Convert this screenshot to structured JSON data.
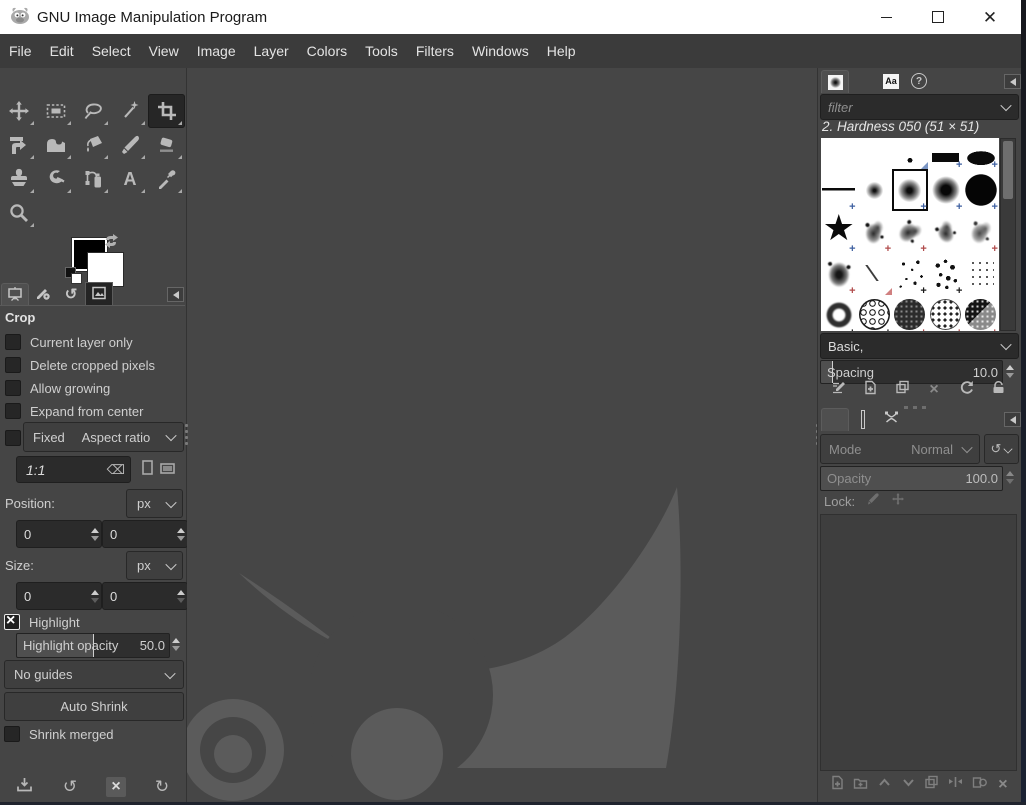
{
  "window": {
    "title": "GNU Image Manipulation Program",
    "controls": [
      "minimize",
      "maximize",
      "close"
    ]
  },
  "menu": {
    "items": [
      "File",
      "Edit",
      "Select",
      "View",
      "Image",
      "Layer",
      "Colors",
      "Tools",
      "Filters",
      "Windows",
      "Help"
    ]
  },
  "toolbox": {
    "selected": "crop",
    "tools": [
      {
        "id": "move"
      },
      {
        "id": "rect-select"
      },
      {
        "id": "free-select"
      },
      {
        "id": "fuzzy-select"
      },
      {
        "id": "crop"
      },
      {
        "id": "unified-transform"
      },
      {
        "id": "warp-transform"
      },
      {
        "id": "bucket-fill"
      },
      {
        "id": "paintbrush"
      },
      {
        "id": "eraser"
      },
      {
        "id": "clone"
      },
      {
        "id": "smudge"
      },
      {
        "id": "airbrush"
      },
      {
        "id": "text"
      },
      {
        "id": "color-picker"
      },
      {
        "id": "zoom"
      }
    ]
  },
  "colors": {
    "foreground": "#000000",
    "background": "#ffffff",
    "canvas_bg": "#464646",
    "watermark": "#5b5b5b",
    "panel_bg": "#454545",
    "menubar_bg": "#3b3b3b",
    "titlebar_bg": "#ffffff",
    "plus_blue": "#3d5fa0",
    "plus_red": "#b04a4a"
  },
  "left_dock_tabs": [
    "tool-options",
    "device-status",
    "undo-history",
    "images"
  ],
  "tool_options": {
    "title": "Crop",
    "checkboxes": [
      {
        "label": "Current layer only",
        "checked": false
      },
      {
        "label": "Delete cropped pixels",
        "checked": false
      },
      {
        "label": "Allow growing",
        "checked": false
      },
      {
        "label": "Expand from center",
        "checked": false
      }
    ],
    "fixed_label": "Fixed",
    "fixed_value": "Aspect ratio",
    "fixed_checked": false,
    "aspect_value": "1:1",
    "position_label": "Position:",
    "position_unit": "px",
    "position_x": "0",
    "position_y": "0",
    "size_label": "Size:",
    "size_unit": "px",
    "size_x": "0",
    "size_y": "0",
    "highlight_label": "Highlight",
    "highlight_checked": true,
    "highlight_opacity_label": "Highlight opacity",
    "highlight_opacity_value": "50.0",
    "highlight_opacity_percent": 50,
    "guides_value": "No guides",
    "auto_shrink_label": "Auto Shrink",
    "shrink_merged_label": "Shrink merged",
    "shrink_merged_checked": false
  },
  "left_footer_icons": [
    "save-preset",
    "restore-preset",
    "delete-preset",
    "reset-defaults"
  ],
  "brushes": {
    "dock_tabs": [
      "brushes",
      "patterns",
      "fonts",
      "document-history"
    ],
    "filter_placeholder": "filter",
    "selected_label": "2. Hardness 050 (51 × 51)",
    "tag_value": "Basic,",
    "spacing_label": "Spacing",
    "spacing_value": "10.0",
    "spacing_percent": 6,
    "action_icons": [
      "edit-brush",
      "new-brush",
      "duplicate-brush",
      "delete-brush",
      "refresh-brushes",
      "open-brush-as-image"
    ],
    "grid": [
      {
        "kind": "blank"
      },
      {
        "kind": "blank"
      },
      {
        "kind": "dot-tiny",
        "mark": "tri-blue"
      },
      {
        "kind": "bar",
        "mark": "plus-blue"
      },
      {
        "kind": "ellipse",
        "mark": "plus-blue"
      },
      {
        "kind": "line",
        "mark": "plus-blue"
      },
      {
        "kind": "soft-small"
      },
      {
        "kind": "soft-mid",
        "sel": true,
        "mark": "plus-blue"
      },
      {
        "kind": "soft-big",
        "mark": "plus-blue"
      },
      {
        "kind": "circle",
        "mark": "plus-blue"
      },
      {
        "kind": "star",
        "mark": "plus-blue"
      },
      {
        "kind": "chalk",
        "mark": "plus-red"
      },
      {
        "kind": "chalk chalk-b",
        "mark": "plus-red"
      },
      {
        "kind": "chalk chalk-c"
      },
      {
        "kind": "chalk chalk-d",
        "mark": "plus-red"
      },
      {
        "kind": "scribble",
        "mark": "plus-red"
      },
      {
        "kind": "slash",
        "mark": "tri-red"
      },
      {
        "kind": "dots-sparse",
        "mark": "plus-black"
      },
      {
        "kind": "dots-mid",
        "mark": "plus-black"
      },
      {
        "kind": "dots-grid"
      },
      {
        "kind": "ring-scribble",
        "mark": "plus-black"
      },
      {
        "kind": "honeycomb",
        "mark": "plus-black"
      },
      {
        "kind": "tex-circle",
        "mark": "plus-red"
      },
      {
        "kind": "dot-circle",
        "mark": "plus-red"
      },
      {
        "kind": "galaxy",
        "mark": "plus-red"
      },
      {
        "kind": "frag"
      },
      {
        "kind": "frag"
      },
      {
        "kind": "frag"
      },
      {
        "kind": "frag"
      },
      {
        "kind": "frag"
      }
    ]
  },
  "layers": {
    "dock_tabs": [
      "layers",
      "channels",
      "paths"
    ],
    "mode_label": "Mode",
    "mode_value": "Normal",
    "opacity_label": "Opacity",
    "opacity_value": "100.0",
    "opacity_percent": 100,
    "lock_label": "Lock:",
    "lock_icons": [
      "lock-pixels",
      "lock-position",
      "lock-alpha"
    ],
    "footer_icons": [
      "new-layer",
      "new-layer-group",
      "raise-layer",
      "lower-layer",
      "duplicate-layer",
      "merge-layer",
      "add-layer-mask",
      "delete-layer"
    ]
  }
}
